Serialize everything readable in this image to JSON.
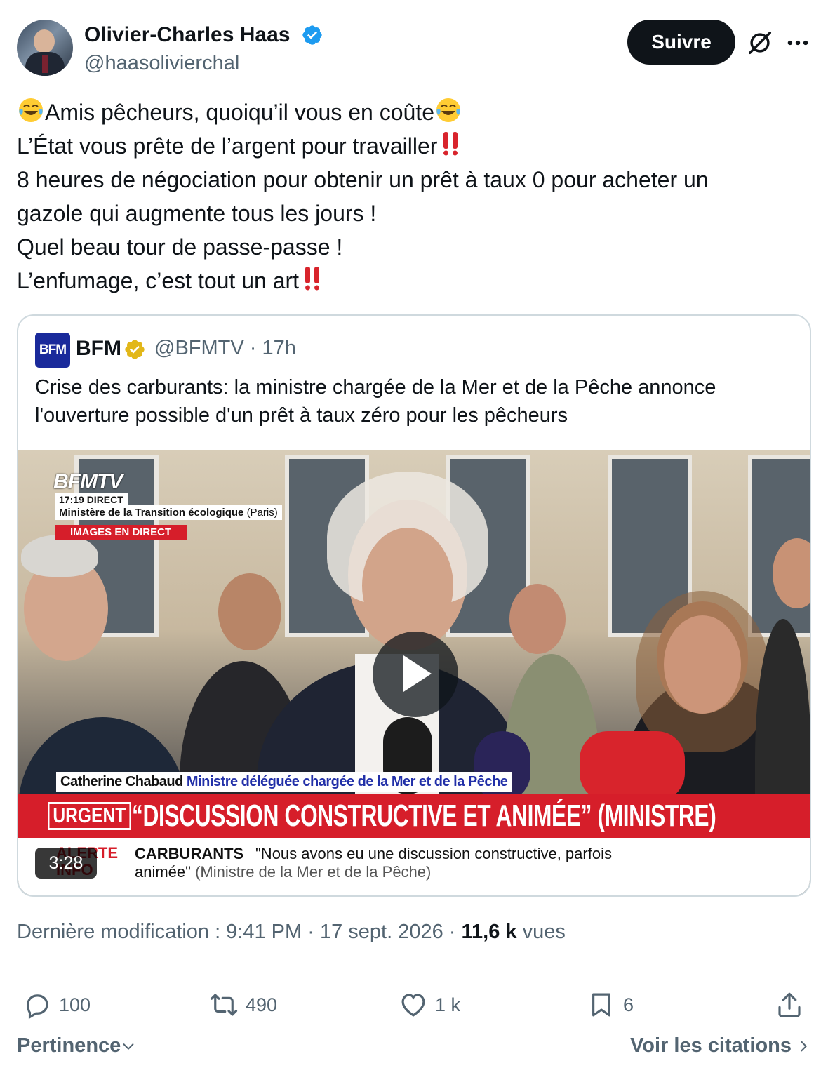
{
  "author": {
    "name": "Olivier-Charles Haas",
    "handle": "@haasolivierchal"
  },
  "header": {
    "follow_label": "Suivre",
    "icons": [
      "verified-badge-icon",
      "grok-icon",
      "more-icon"
    ]
  },
  "tweet": {
    "lines": [
      "Amis pêcheurs, quoiqu’il vous en coûte",
      "L’État vous prête de l’argent pour travailler",
      "8 heures de négociation pour obtenir un prêt à taux 0 pour acheter un",
      "gazole qui augmente tous les jours !",
      "Quel beau tour de passe-passe !",
      "L’enfumage, c’est tout un art"
    ]
  },
  "quote": {
    "logo_text": "BFM",
    "name": "BFM",
    "handle": "@BFMTV",
    "time": "· 17h",
    "text": "Crise des carburants: la ministre chargée de la Mer et de la Pêche annonce l'ouverture possible d'un prêt à taux zéro pour les pêcheurs",
    "video": {
      "channel": "BFMTV",
      "live": "17:19  DIRECT",
      "location": "Ministère de la Transition écologique",
      "location_city": "(Paris)",
      "images_label": "IMAGES EN DIRECT",
      "speaker_name": "Catherine Chabaud",
      "speaker_role": "Ministre déléguée chargée de la Mer et de la Pêche",
      "urgent_label": "URGENT",
      "headline": "“DISCUSSION CONSTRUCTIVE ET ANIMÉE” (MINISTRE)",
      "ticker_alert": "ALERTE INFO",
      "ticker_title": "CARBURANTS",
      "ticker_text": "\"Nous avons eu une discussion constructive, parfois animée\"",
      "ticker_source": "(Ministre de la Mer et de la Pêche)",
      "duration": "3:28"
    }
  },
  "meta": {
    "prefix": "Dernière modification : 9:41 PM · 17 sept. 2026 ·",
    "views": "11,6 k",
    "views_label": "vues"
  },
  "actions": {
    "replies": "100",
    "reposts": "490",
    "likes": "1 k",
    "bookmarks": "6"
  },
  "footer": {
    "sort_label": "Pertinence",
    "quotes_label": "Voir les citations"
  },
  "colors": {
    "accent": "#1d9bf0",
    "text_secondary": "#536471",
    "bfm_blue": "#1a2a9b",
    "urgent_red": "#d61e2a",
    "gold_badge": "#e2b719"
  }
}
